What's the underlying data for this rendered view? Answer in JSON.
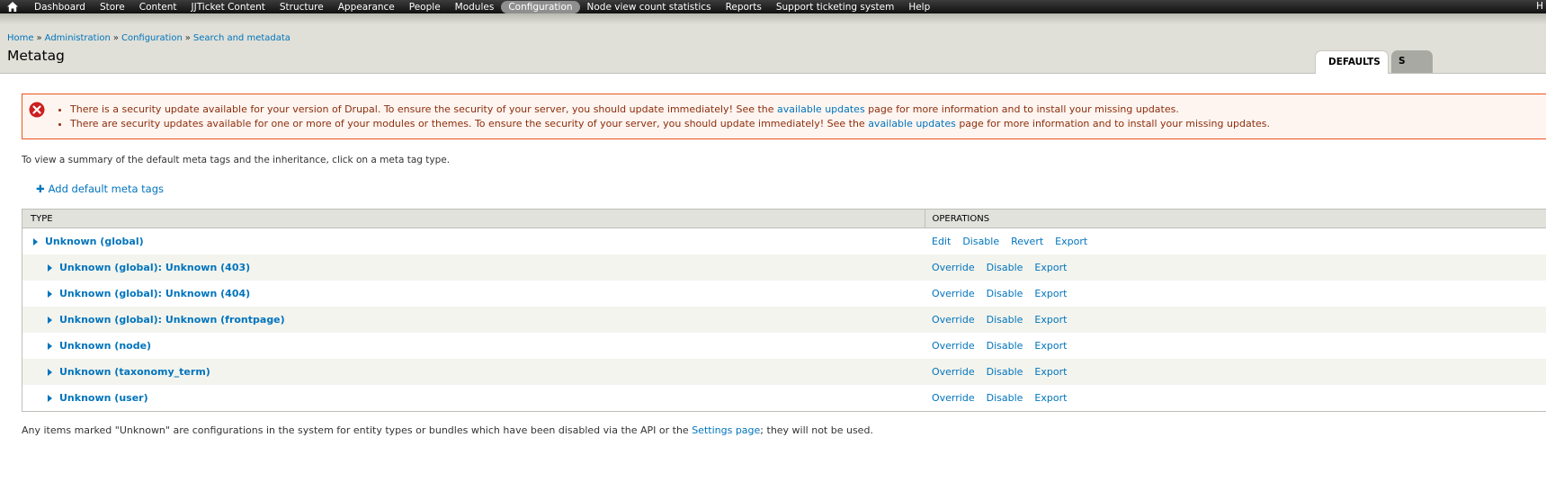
{
  "toolbar": {
    "items": [
      {
        "label": "Dashboard"
      },
      {
        "label": "Store"
      },
      {
        "label": "Content"
      },
      {
        "label": "JJTicket Content"
      },
      {
        "label": "Structure"
      },
      {
        "label": "Appearance"
      },
      {
        "label": "People"
      },
      {
        "label": "Modules"
      },
      {
        "label": "Configuration"
      },
      {
        "label": "Node view count statistics"
      },
      {
        "label": "Reports"
      },
      {
        "label": "Support ticketing system"
      },
      {
        "label": "Help"
      }
    ],
    "active": "Configuration",
    "home_icon": "home-icon",
    "right_label": "H"
  },
  "breadcrumb": {
    "items": [
      "Home",
      "Administration",
      "Configuration",
      "Search and metadata"
    ],
    "separator": "»"
  },
  "page": {
    "title": "Metatag"
  },
  "tabs": [
    {
      "label": "DEFAULTS",
      "active": true
    },
    {
      "label": "S",
      "active": false
    }
  ],
  "messages": {
    "icon": "error-icon",
    "items": [
      {
        "before": "There is a security update available for your version of Drupal. To ensure the security of your server, you should update immediately! See the ",
        "link": "available updates",
        "after": " page for more information and to install your missing updates."
      },
      {
        "before": "There are security updates available for one or more of your modules or themes. To ensure the security of your server, you should update immediately! See the ",
        "link": "available updates",
        "after": " page for more information and to install your missing updates."
      }
    ]
  },
  "intro": "To view a summary of the default meta tags and the inheritance, click on a meta tag type.",
  "action": {
    "label": "Add default meta tags",
    "icon": "plus-icon"
  },
  "table": {
    "headers": {
      "type": "TYPE",
      "operations": "OPERATIONS"
    },
    "rows": [
      {
        "type": "Unknown (global)",
        "ops": [
          "Edit",
          "Disable",
          "Revert",
          "Export"
        ]
      },
      {
        "type": "Unknown (global): Unknown (403)",
        "ops": [
          "Override",
          "Disable",
          "Export"
        ]
      },
      {
        "type": "Unknown (global): Unknown (404)",
        "ops": [
          "Override",
          "Disable",
          "Export"
        ]
      },
      {
        "type": "Unknown (global): Unknown (frontpage)",
        "ops": [
          "Override",
          "Disable",
          "Export"
        ]
      },
      {
        "type": "Unknown (node)",
        "ops": [
          "Override",
          "Disable",
          "Export"
        ]
      },
      {
        "type": "Unknown (taxonomy_term)",
        "ops": [
          "Override",
          "Disable",
          "Export"
        ]
      },
      {
        "type": "Unknown (user)",
        "ops": [
          "Override",
          "Disable",
          "Export"
        ]
      }
    ]
  },
  "footnote": {
    "before": "Any items marked \"Unknown\" are configurations in the system for entity types or bundles which have been disabled via the API or the ",
    "link": "Settings page",
    "after": "; they will not be used."
  }
}
